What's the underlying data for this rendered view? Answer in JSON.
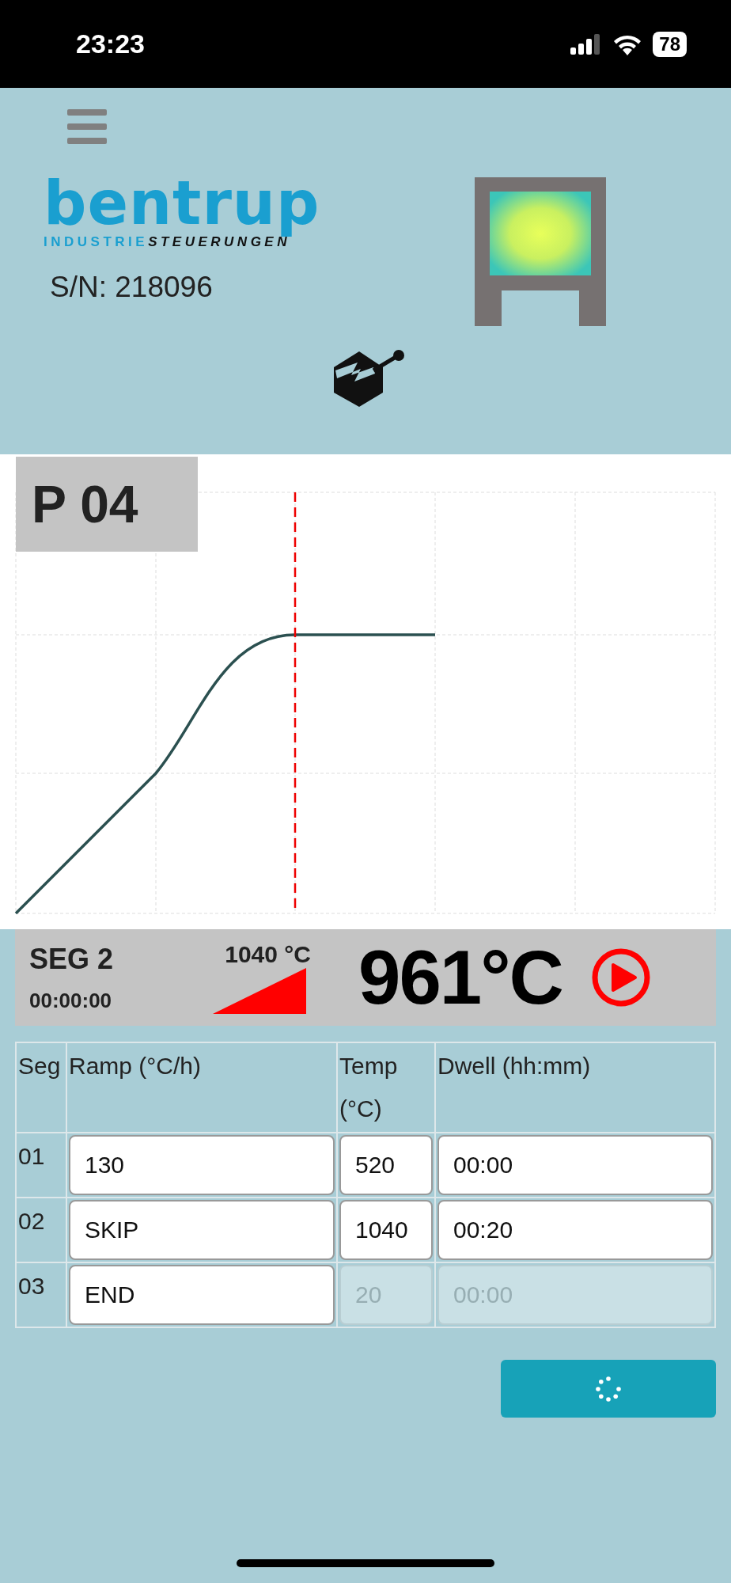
{
  "status_bar": {
    "time": "23:23",
    "battery": "78"
  },
  "header": {
    "brand": "bentrup",
    "tagline": {
      "plain": "INDUSTRIE",
      "italic": "STEUERUNGEN"
    },
    "serial": "S/N: 218096"
  },
  "program": {
    "label": "P 04"
  },
  "segment": {
    "label": "SEG 2",
    "elapsed": "00:00:00",
    "target": "1040 °C",
    "temperature": "961°C",
    "running": true
  },
  "table": {
    "columns": [
      "Seg",
      "Ramp (°C/h)",
      "Temp (°C)",
      "Dwell (hh:mm)"
    ],
    "rows": [
      {
        "seg": "01",
        "ramp": "130",
        "temp": "520",
        "dwell": "00:00",
        "disabled": false
      },
      {
        "seg": "02",
        "ramp": "SKIP",
        "temp": "1040",
        "dwell": "00:20",
        "disabled": false
      },
      {
        "seg": "03",
        "ramp": "END",
        "temp": "20",
        "dwell": "00:00",
        "disabled": true
      }
    ]
  },
  "save_button": {
    "busy": true
  }
}
